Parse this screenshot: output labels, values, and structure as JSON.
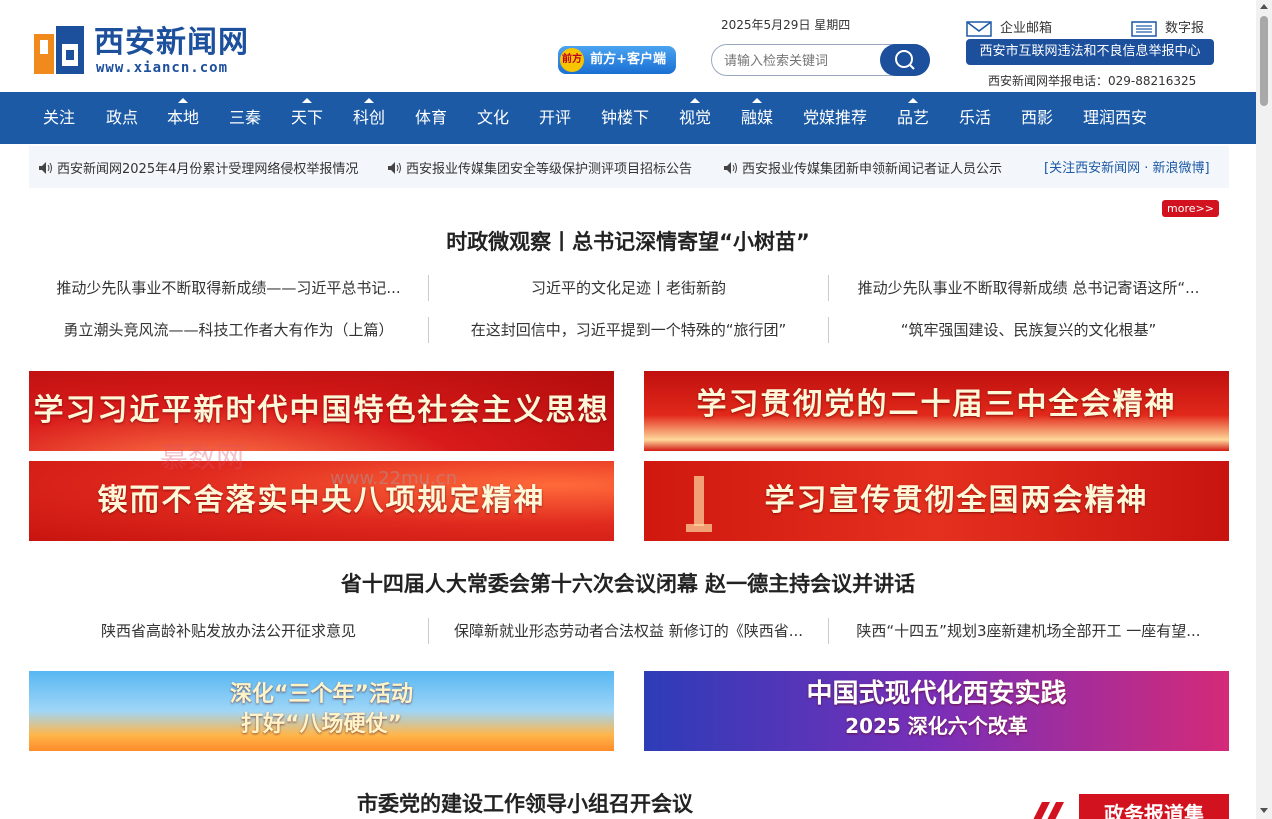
{
  "site": {
    "name": "西安新闻网",
    "url": "www.xiancn.com",
    "logo_mark": "西"
  },
  "header": {
    "date": "2025年5月29日 星期四",
    "client_label": "前方+客户端",
    "client_badge": "前方",
    "search_placeholder": "请输入检索关键词",
    "mail_label": "企业邮箱",
    "paper_label": "数字报",
    "report_center": "西安市互联网违法和不良信息举报中心",
    "report_phone": "西安新闻网举报电话：029-88216325"
  },
  "nav": [
    "关注",
    "政点",
    "本地",
    "三秦",
    "天下",
    "科创",
    "体育",
    "文化",
    "开评",
    "钟楼下",
    "视觉",
    "融媒",
    "党媒推荐",
    "品艺",
    "乐活",
    "西影",
    "理润西安"
  ],
  "ticker": {
    "items": [
      "西安新闻网2025年4月份累计受理网络侵权举报情况",
      "西安报业传媒集团安全等级保护测评项目招标公告",
      "西安报业传媒集团新申领新闻记者证人员公示"
    ],
    "weibo": "[关注西安新闻网 · 新浪微博]"
  },
  "more_label": "more>>",
  "sections": [
    {
      "headline": "时政微观察丨总书记深情寄望“小树苗”",
      "rows": [
        [
          "推动少先队事业不断取得新成绩——习近平总书记...",
          "习近平的文化足迹丨老街新韵",
          "推动少先队事业不断取得新成绩 总书记寄语这所“..."
        ],
        [
          "勇立潮头竞风流——科技工作者大有作为（上篇）",
          "在这封回信中，习近平提到一个特殊的“旅行团”",
          "“筑牢强国建设、民族复兴的文化根基”"
        ]
      ]
    },
    {
      "headline": "省十四届人大常委会第十六次会议闭幕 赵一德主持会议并讲话",
      "rows": [
        [
          "陕西省高龄补贴发放办法公开征求意见",
          "保障新就业形态劳动者合法权益 新修订的《陕西省...",
          "陕西“十四五”规划3座新建机场全部开工 一座有望..."
        ]
      ]
    },
    {
      "headline": "市委党的建设工作领导小组召开会议",
      "rows": []
    }
  ],
  "banners": [
    "学习习近平新时代中国特色社会主义思想",
    "学习贯彻党的二十届三中全会精神",
    "锲而不舍落实中央八项规定精神",
    "学习宣传贯彻全国两会精神"
  ],
  "banners2": [
    {
      "line1": "深化“三个年”活动",
      "line2": "打好“八场硬仗”"
    },
    {
      "line1": "中国式现代化西安实践",
      "line2": "2025 深化六个改革"
    }
  ],
  "watermark": {
    "brand": "慕数网",
    "url": "www.22mu.cn"
  },
  "gov_tag": "政务报道集",
  "colors": {
    "brand_blue": "#1c5aa6",
    "accent_red": "#d3121f"
  }
}
